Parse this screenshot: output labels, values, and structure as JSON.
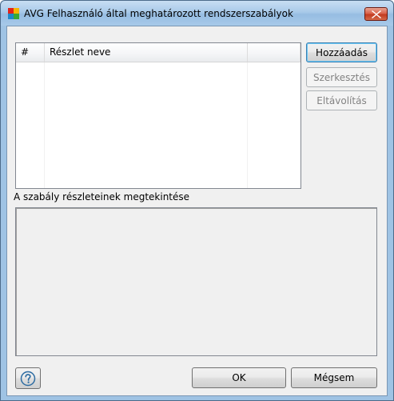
{
  "window": {
    "title": "AVG Felhasználó által meghatározott rendszerszabályok",
    "close_icon": "close-icon",
    "app_icon": "avg-logo-icon"
  },
  "list": {
    "columns": [
      "#",
      "Részlet neve",
      ""
    ],
    "rows": []
  },
  "buttons": {
    "add": "Hozzáadás",
    "edit": "Szerkesztés",
    "remove": "Eltávolítás",
    "ok": "OK",
    "cancel": "Mégsem"
  },
  "preview": {
    "label": "A szabály részleteinek megtekintése",
    "content": ""
  },
  "help": {
    "icon": "help-icon"
  },
  "colors": {
    "frame": "#9fc3e4",
    "client": "#f0f0f0",
    "close_button": "#c8462a"
  }
}
